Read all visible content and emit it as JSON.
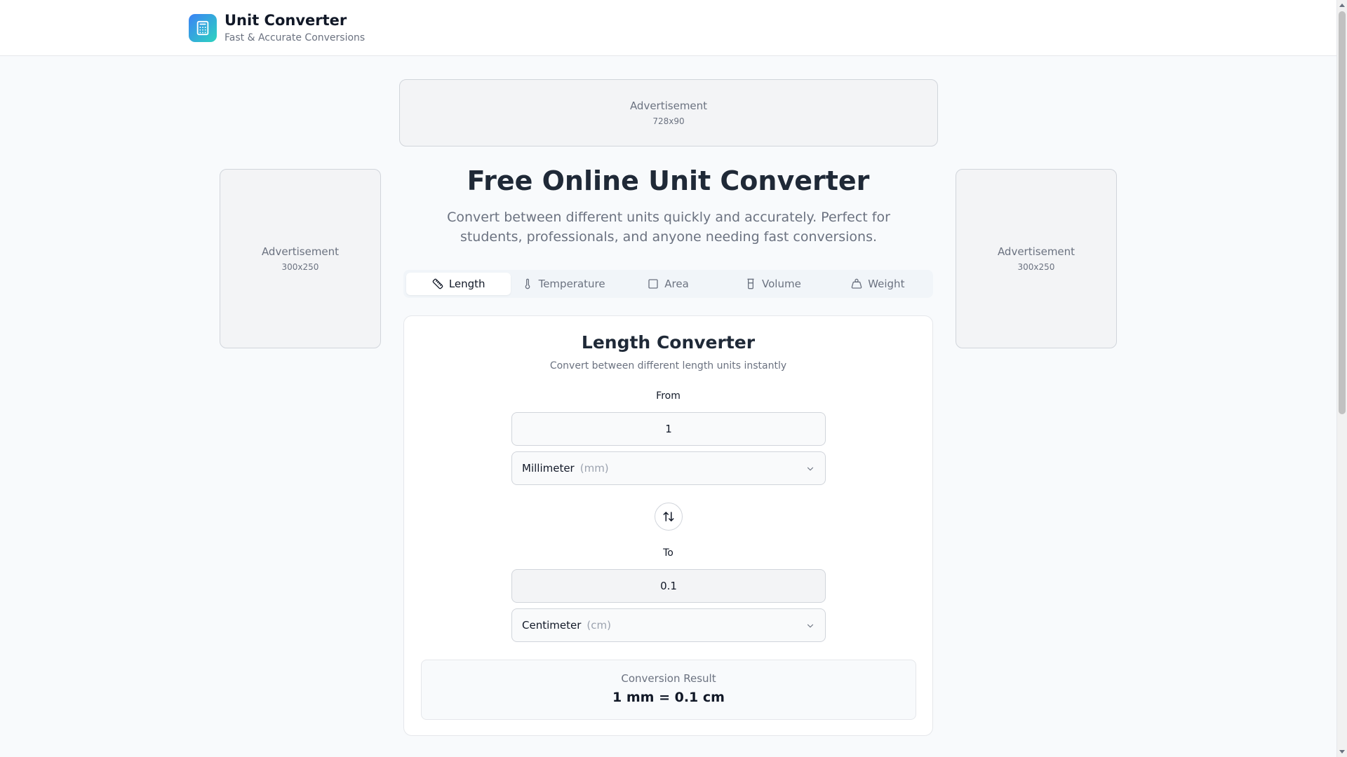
{
  "header": {
    "title": "Unit Converter",
    "subtitle": "Fast & Accurate Conversions",
    "logo_icon": "calculator-icon"
  },
  "ads": {
    "top": {
      "label": "Advertisement",
      "size": "728x90"
    },
    "left": {
      "label": "Advertisement",
      "size": "300x250"
    },
    "right": {
      "label": "Advertisement",
      "size": "300x250"
    }
  },
  "hero": {
    "title": "Free Online Unit Converter",
    "description": "Convert between different units quickly and accurately. Perfect for students, professionals, and anyone needing fast conversions."
  },
  "tabs": [
    {
      "label": "Length",
      "icon": "ruler-icon",
      "active": true
    },
    {
      "label": "Temperature",
      "icon": "thermometer-icon",
      "active": false
    },
    {
      "label": "Area",
      "icon": "square-icon",
      "active": false
    },
    {
      "label": "Volume",
      "icon": "beaker-icon",
      "active": false
    },
    {
      "label": "Weight",
      "icon": "weight-icon",
      "active": false
    }
  ],
  "converter": {
    "title": "Length Converter",
    "subtitle": "Convert between different length units instantly",
    "from": {
      "label": "From",
      "value": "1",
      "unit_name": "Millimeter",
      "unit_abbr": "(mm)"
    },
    "to": {
      "label": "To",
      "value": "0.1",
      "unit_name": "Centimeter",
      "unit_abbr": "(cm)"
    },
    "swap_icon": "swap-vertical-icon",
    "result": {
      "label": "Conversion Result",
      "value": "1 mm = 0.1 cm"
    }
  },
  "colors": {
    "accent_gradient_start": "#3b82f6",
    "accent_gradient_end": "#2dd4bf",
    "background": "#f8fafc"
  }
}
